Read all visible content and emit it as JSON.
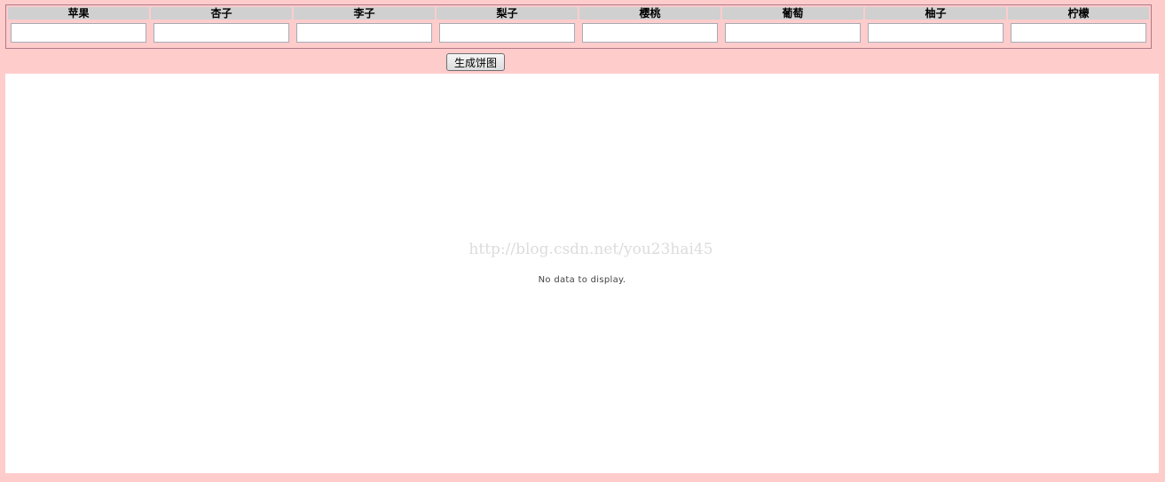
{
  "fruits": {
    "headers": [
      "苹果",
      "杏子",
      "李子",
      "梨子",
      "樱桃",
      "葡萄",
      "柚子",
      "柠檬"
    ],
    "values": [
      "",
      "",
      "",
      "",
      "",
      "",
      "",
      ""
    ]
  },
  "actions": {
    "generate_label": "生成饼图"
  },
  "chart": {
    "watermark": "http://blog.csdn.net/you23hai45",
    "empty_message": "No data to display."
  },
  "colors": {
    "page_background": "#ffcccc",
    "header_background": "#d0d0d0",
    "chart_background": "#ffffff"
  }
}
